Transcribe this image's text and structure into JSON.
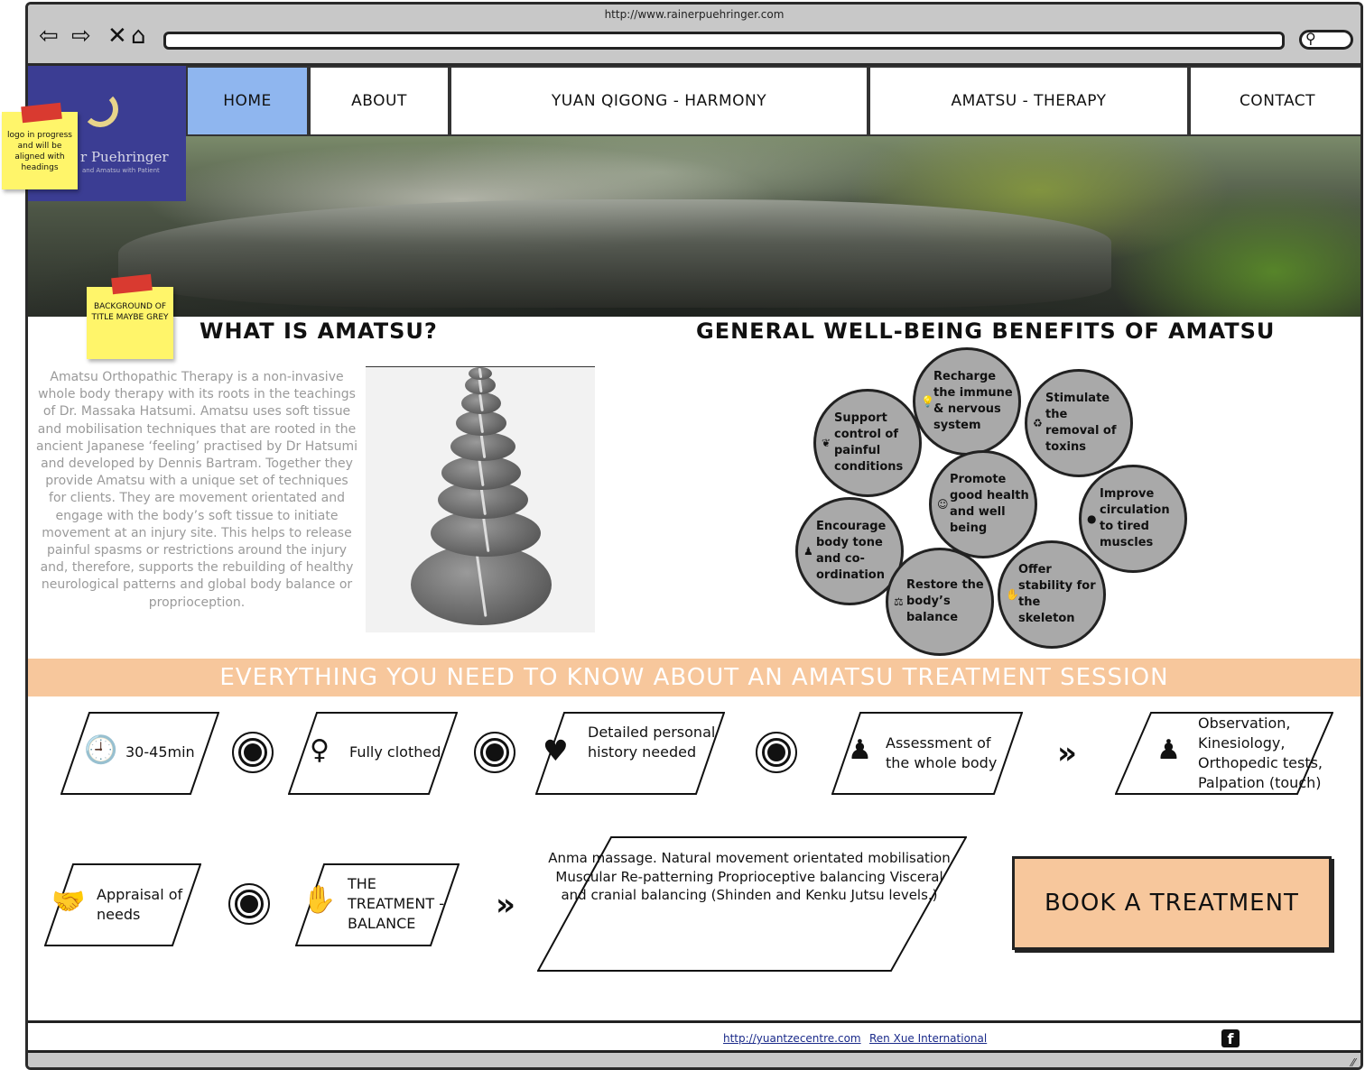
{
  "browser": {
    "url": "http://www.rainerpuehringer.com",
    "back_icon": "back-arrow-icon",
    "forward_icon": "forward-arrow-icon",
    "close_icon": "close-icon",
    "home_icon": "home-icon",
    "search_icon": "search-icon"
  },
  "logo": {
    "name": "r Puehringer",
    "tagline": "and Amatsu with Patient"
  },
  "notes": {
    "logo": "logo in progress and will be aligned with headings",
    "title_bg": "BACKGROUND OF TITLE MAYBE GREY"
  },
  "nav": {
    "items": [
      {
        "label": "HOME",
        "active": true
      },
      {
        "label": "ABOUT",
        "active": false
      },
      {
        "label": "YUAN QIGONG - HARMONY",
        "active": false
      },
      {
        "label": "AMATSU - THERAPY",
        "active": false
      },
      {
        "label": "CONTACT",
        "active": false
      }
    ]
  },
  "about": {
    "title": "WHAT IS AMATSU?",
    "body": "Amatsu Orthopathic Therapy is a non-invasive whole body therapy with its roots in the teachings of Dr. Massaka Hatsumi. Amatsu uses soft tissue and mobilisation techniques that are rooted in the ancient Japanese ‘feeling’ practised by Dr Hatsumi and developed by Dennis Bartram. Together they provide Amatsu with a unique set of techniques for clients. They are movement orientated and engage with the body’s soft tissue to initiate movement at an injury site. This helps to release painful spasms or restrictions around the injury and, therefore, supports the rebuilding of healthy neurological patterns and global body balance or proprioception."
  },
  "benefits": {
    "title": "GENERAL WELL-BEING BENEFITS OF AMATSU",
    "items": [
      {
        "label": "Recharge the immune & nervous system",
        "icon": "lightbulb-icon"
      },
      {
        "label": "Support control of painful conditions",
        "icon": "leaf-icon"
      },
      {
        "label": "Stimulate the removal of toxins",
        "icon": "recycle-icon"
      },
      {
        "label": "Promote good health and well being",
        "icon": "smile-icon"
      },
      {
        "label": "Improve circulation to tired muscles",
        "icon": "drop-icon"
      },
      {
        "label": "Encourage body tone and co-ordination",
        "icon": "person-icon"
      },
      {
        "label": "Restore the body’s balance",
        "icon": "balance-icon"
      },
      {
        "label": "Offer stability for the skeleton",
        "icon": "hand-icon"
      }
    ]
  },
  "session": {
    "banner": "EVERYTHING YOU NEED TO KNOW ABOUT AN AMATSU TREATMENT SESSION",
    "steps": [
      {
        "label": "30-45min",
        "icon": "clock-icon"
      },
      {
        "label": "Fully clothed",
        "icon": "woman-icon"
      },
      {
        "label": "Detailed personal history needed",
        "icon": "heartbeat-icon"
      },
      {
        "label": "Assessment of the whole body",
        "icon": "person-icon"
      },
      {
        "label": "Observation, Kinesiology, Orthopedic tests, Palpation (touch)",
        "icon": "person-icon"
      },
      {
        "label": "Appraisal of needs",
        "icon": "handshake-icon"
      },
      {
        "label": "THE TREATMENT - BALANCE",
        "icon": "hand-icon"
      },
      {
        "label": "Anma massage. Natural movement orientated mobilisation Muscular Re-patterning Proprioceptive balancing Visceral and cranial balancing (Shinden and Kenku Jutsu levels.)",
        "icon": ""
      }
    ],
    "connector_icon": "target-icon",
    "arrow_icon": "double-chevron-icon"
  },
  "cta": {
    "label": "BOOK A TREATMENT"
  },
  "footer": {
    "link1": "http://yuantzecentre.com",
    "link2": "Ren Xue International",
    "social_icon": "facebook-icon"
  }
}
